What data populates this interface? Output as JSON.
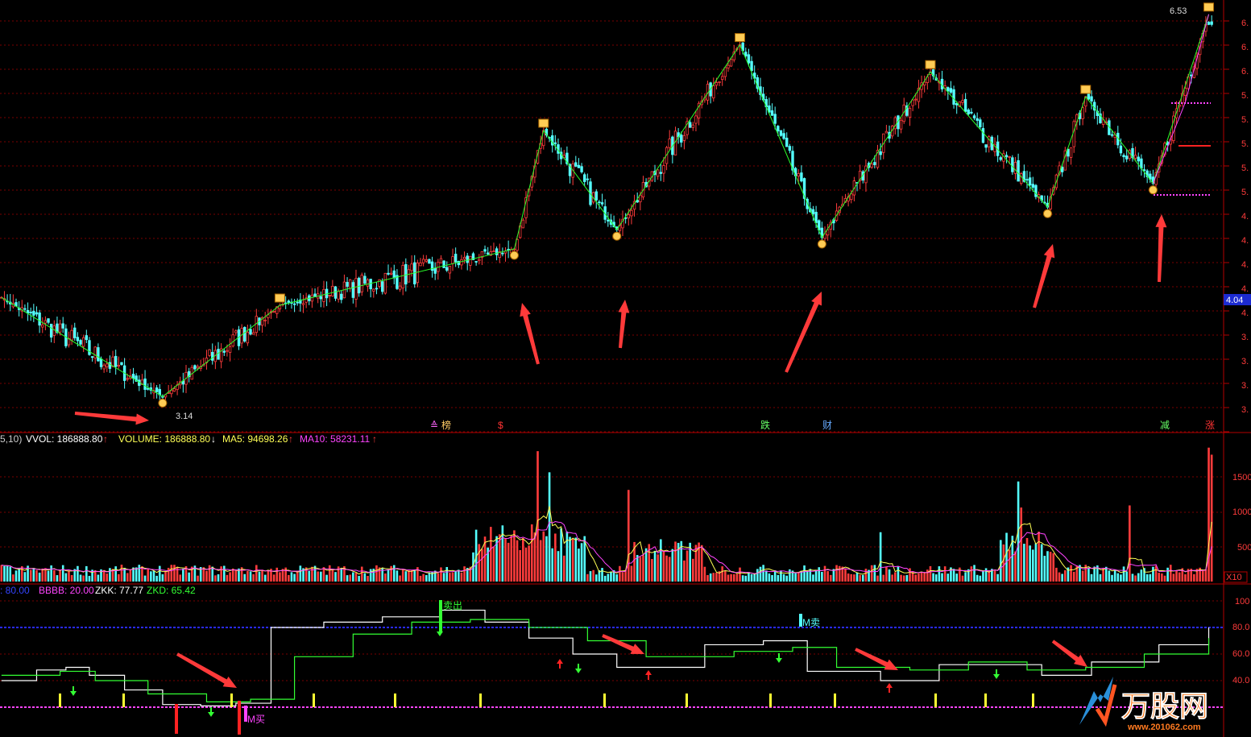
{
  "colors": {
    "up": "#ff3c3c",
    "down": "#54ffff",
    "grid": "#7a0000",
    "axis": "#b40000",
    "zigzag": "#2aff2a",
    "ma5": "#ffff55",
    "ma10": "#ff44ff",
    "kdj_k": "#ffffff",
    "kdj_d": "#33ff33",
    "level80": "#2a2aff",
    "level20": "#ff44ff",
    "arrow": "#ff3a3a"
  },
  "price_panel": {
    "axis_labels": [
      "6.",
      "6.",
      "6.",
      "5.",
      "5.",
      "5.",
      "5.",
      "5.",
      "4.",
      "4.",
      "4.",
      "4.",
      "4.",
      "3.",
      "3.",
      "3.",
      "3."
    ],
    "current_price": "4.04",
    "high_label": "6.53",
    "low_label": "3.14",
    "events": [
      {
        "label": "榜",
        "color": "#ffcc66"
      },
      {
        "label": "$",
        "color": "#ff3333"
      },
      {
        "label": "跌",
        "color": "#66ff66"
      },
      {
        "label": "财",
        "color": "#66aaff"
      },
      {
        "label": "减",
        "color": "#66ff66"
      },
      {
        "label": "涨",
        "color": "#ff3333"
      }
    ]
  },
  "volume_panel": {
    "header": {
      "params": "5,10)",
      "vol": "VVOL: 186888.80",
      "vol_arrow": "↑",
      "volume": "VOLUME: 186888.80",
      "volume_arrow": "↓",
      "ma5": "MA5: 94698.26",
      "ma5_arrow": "↑",
      "ma10": "MA10: 58231.11",
      "ma10_arrow": "↑"
    },
    "axis_labels": [
      "1500",
      "1000",
      "500"
    ],
    "unit": "X10"
  },
  "kdj_panel": {
    "header": {
      "aaaa": ": 80.00",
      "bbbb": "BBBB: 20.00",
      "zkk": "ZKK: 77.77",
      "zkd": "ZKD: 65.42"
    },
    "axis_labels": [
      "100",
      "80.0",
      "60.0",
      "40.0"
    ],
    "sell_label": "卖出",
    "m_sell_label": "M卖",
    "m_buy_label": "M买"
  },
  "watermark": {
    "text": "万股网",
    "url": "www.201062.com"
  },
  "chart_data": [
    {
      "type": "candlestick",
      "title": "",
      "ylim": [
        3.0,
        6.6
      ],
      "zigzag": [
        {
          "i": 0,
          "v": 4.02
        },
        {
          "i": 55,
          "v": 3.14
        },
        {
          "i": 95,
          "v": 3.95
        },
        {
          "i": 175,
          "v": 4.45
        },
        {
          "i": 185,
          "v": 5.5
        },
        {
          "i": 210,
          "v": 4.62
        },
        {
          "i": 252,
          "v": 6.26
        },
        {
          "i": 280,
          "v": 4.55
        },
        {
          "i": 317,
          "v": 6.02
        },
        {
          "i": 357,
          "v": 4.82
        },
        {
          "i": 370,
          "v": 5.8
        },
        {
          "i": 393,
          "v": 5.03
        },
        {
          "i": 412,
          "v": 6.53
        }
      ]
    },
    {
      "type": "bar",
      "title": "",
      "ylim": [
        0,
        2000
      ],
      "series": [
        {
          "name": "VOLUME",
          "values": []
        },
        {
          "name": "MA5",
          "values": []
        },
        {
          "name": "MA10",
          "values": []
        }
      ]
    },
    {
      "type": "line",
      "title": "",
      "ylim": [
        0,
        100
      ],
      "series": [
        {
          "name": "ZKK",
          "last": 77.77
        },
        {
          "name": "ZKD",
          "last": 65.42
        }
      ],
      "levels": [
        80,
        20
      ]
    }
  ]
}
